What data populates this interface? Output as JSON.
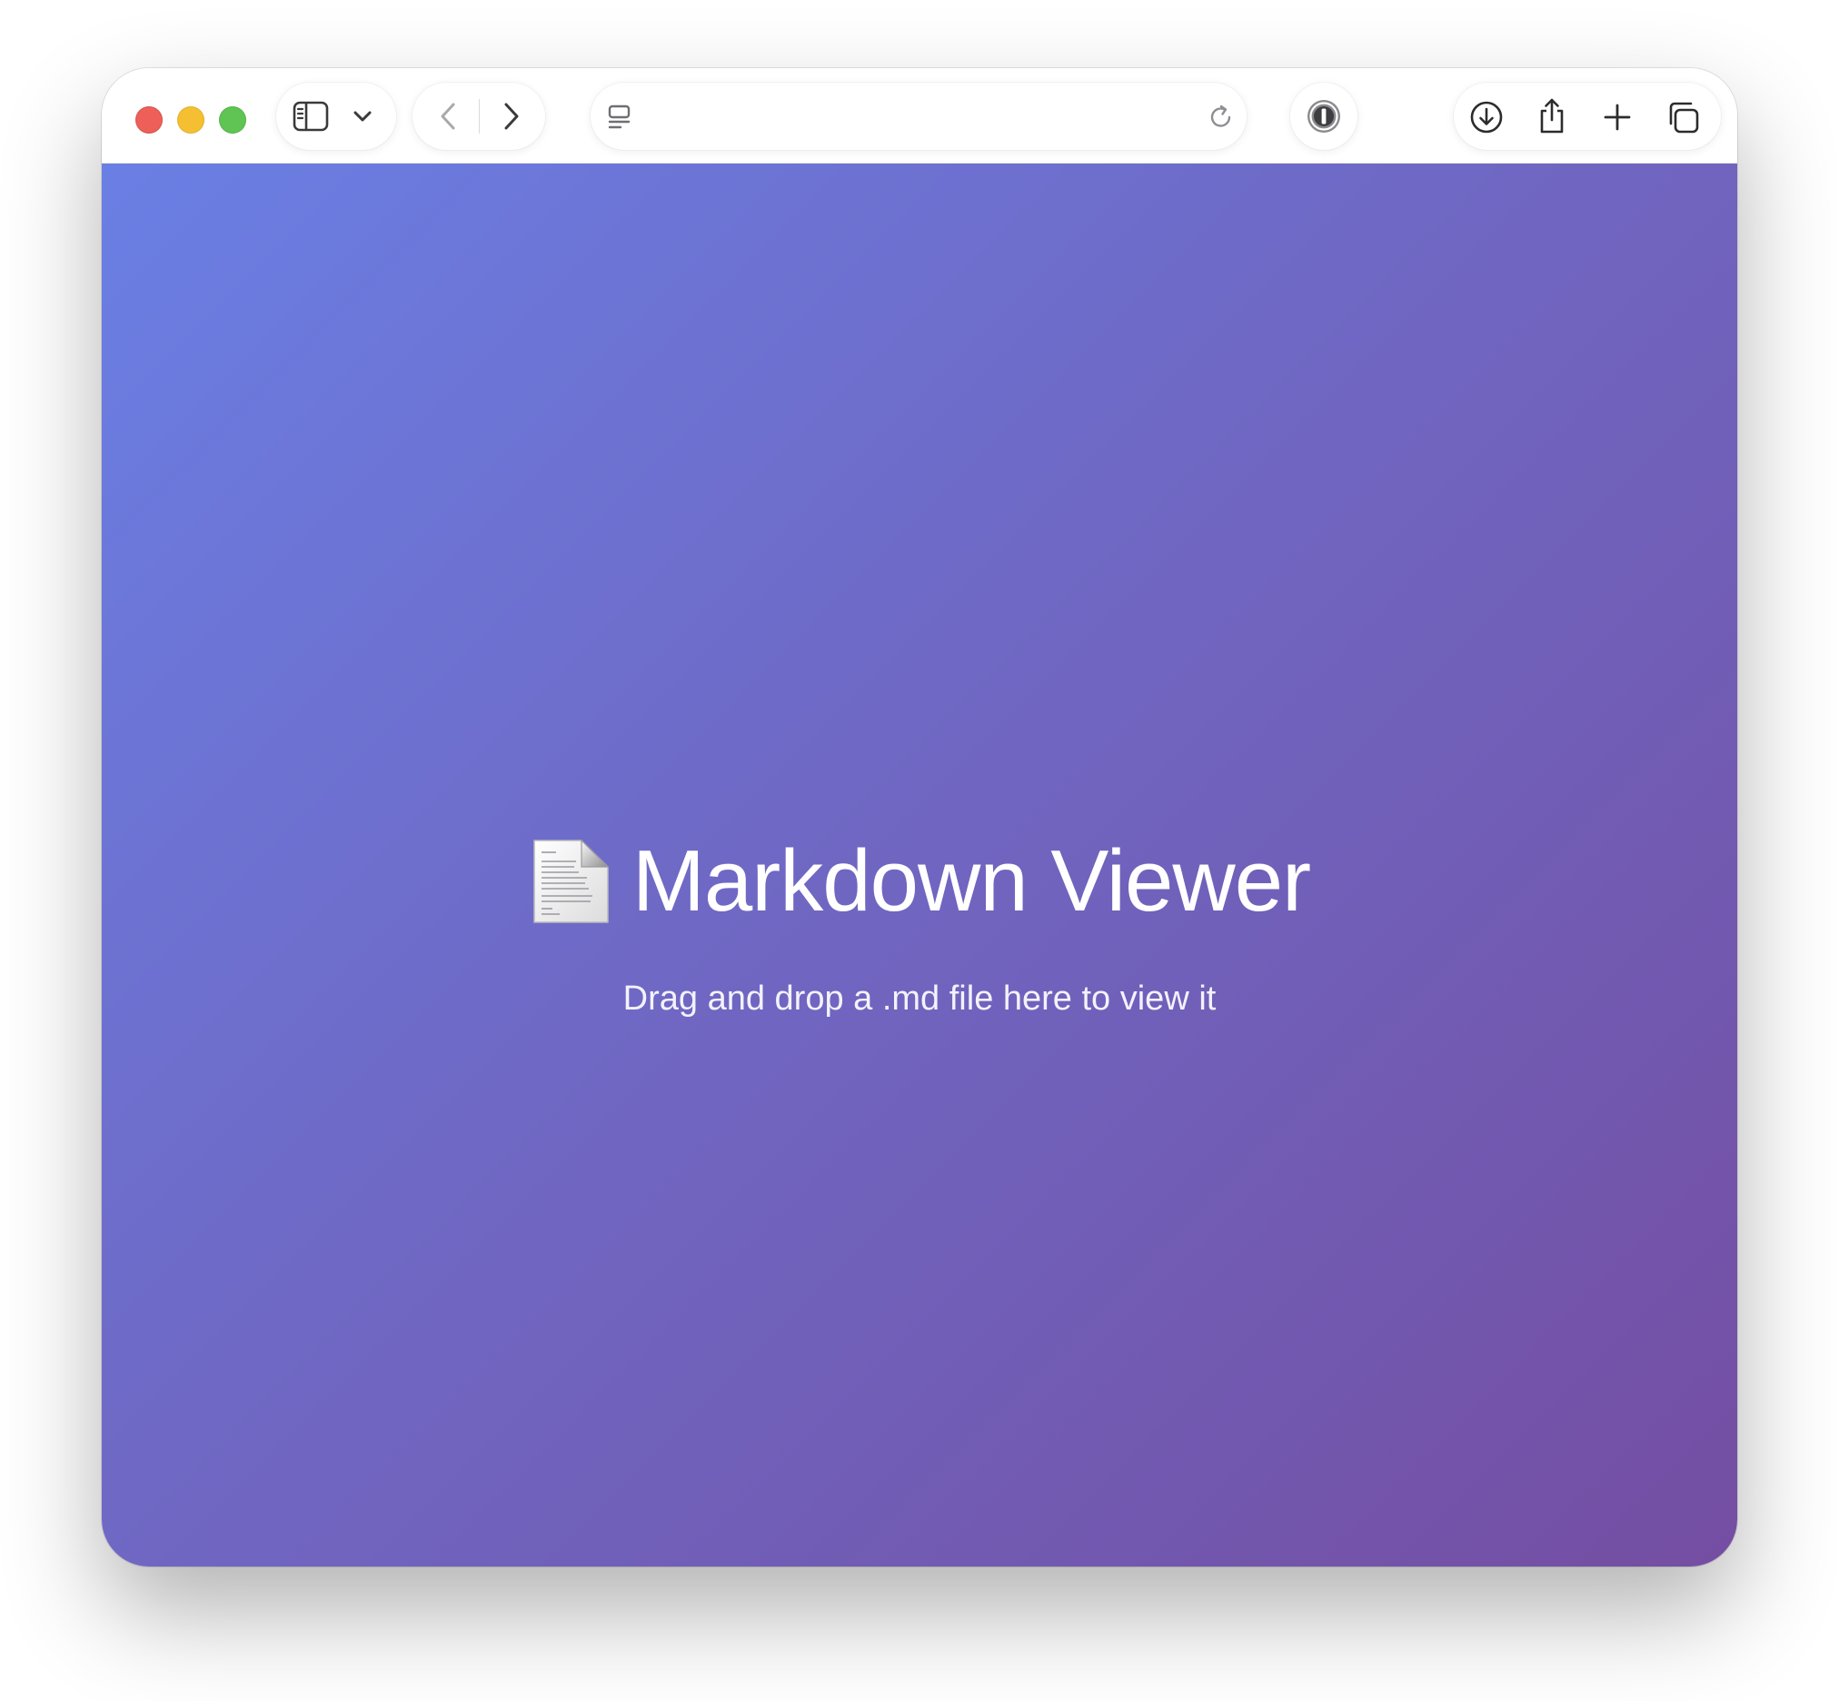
{
  "window": {
    "traffic_lights": [
      {
        "name": "close",
        "color": "#ed5f58"
      },
      {
        "name": "minimize",
        "color": "#f4c031"
      },
      {
        "name": "zoom",
        "color": "#5fc453"
      }
    ]
  },
  "toolbar": {
    "icons": {
      "sidebar": "sidebar-toggle-icon",
      "sidebar_menu": "chevron-down-icon",
      "back": "chevron-left-icon",
      "forward": "chevron-right-icon",
      "page_menu": "page-menu-icon",
      "reload": "reload-icon",
      "password_manager": "password-manager-icon",
      "downloads": "download-icon",
      "share": "share-icon",
      "new_tab": "plus-icon",
      "tab_overview": "tab-overview-icon"
    },
    "back_enabled": false,
    "forward_enabled": true
  },
  "page": {
    "background_gradient": [
      "#6a7fe4",
      "#744ea2"
    ],
    "icon": "document-icon",
    "title": "Markdown Viewer",
    "subtitle": "Drag and drop a .md file here to view it"
  }
}
